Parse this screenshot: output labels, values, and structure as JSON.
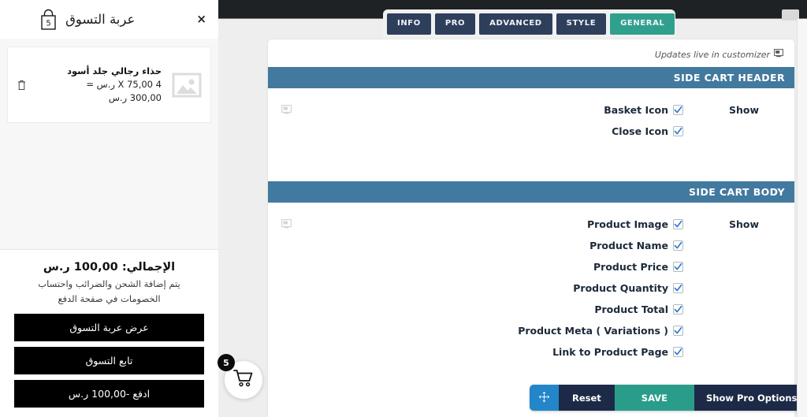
{
  "side_cart": {
    "title": "عربة التسوق",
    "basket_count": "5",
    "close_label": "×",
    "item": {
      "name": "حذاء رجالي جلد أسود",
      "qty_line": "4 X 75,00 ر.س =",
      "total_line": "300,00 ر.س",
      "remove_icon": "trash-icon",
      "thumb_icon": "image-placeholder-icon"
    },
    "footer": {
      "total": "الإجمالي: 100,00 ر.س",
      "note": "يتم إضافة الشحن والضرائب واحتساب الخصومات في صفحة الدفع",
      "buttons": [
        "عرض عربة التسوق",
        "تابع التسوق",
        "ادفع -100,00 ر.س"
      ]
    },
    "bubble": {
      "badge": "5",
      "icon": "shopping-cart-icon"
    }
  },
  "admin": {
    "tabs": [
      {
        "label": "INFO",
        "active": false
      },
      {
        "label": "PRO",
        "active": false
      },
      {
        "label": "ADVANCED",
        "active": false
      },
      {
        "label": "STYLE",
        "active": false
      },
      {
        "label": "GENERAL",
        "active": true
      }
    ],
    "customizer_note": "Updates live in customizer",
    "customizer_icon": "monitor-icon",
    "sections": [
      {
        "title": "SIDE CART HEADER",
        "show_label": "Show",
        "options": [
          {
            "label": "Basket Icon",
            "checked": true
          },
          {
            "label": "Close Icon",
            "checked": true
          }
        ]
      },
      {
        "title": "SIDE CART BODY",
        "show_label": "Show",
        "options": [
          {
            "label": "Product Image",
            "checked": true
          },
          {
            "label": "Product Name",
            "checked": true
          },
          {
            "label": "Product Price",
            "checked": true
          },
          {
            "label": "Product Quantity",
            "checked": true
          },
          {
            "label": "Product Total",
            "checked": true
          },
          {
            "label": "Product Meta ( Variations )",
            "checked": true
          },
          {
            "label": "Link to Product Page",
            "checked": true
          }
        ]
      }
    ],
    "actions": [
      {
        "label": "",
        "name": "move-handle-button",
        "icon": "move-arrows-icon",
        "style": "act-move"
      },
      {
        "label": "Reset",
        "name": "reset-button",
        "icon": "",
        "style": "act-reset"
      },
      {
        "label": "SAVE",
        "name": "save-button",
        "icon": "",
        "style": "act-save"
      },
      {
        "label": "Show Pro Options",
        "name": "show-pro-options-button",
        "icon": "",
        "style": "act-pro"
      }
    ]
  },
  "colors": {
    "section_header": "#42799f",
    "tab_active": "#2fa08d",
    "tab_inactive": "#2e3f5c",
    "save": "#2a9d8a",
    "navy": "#1d2a47",
    "move": "#2286c8",
    "cart_button": "#000000"
  }
}
